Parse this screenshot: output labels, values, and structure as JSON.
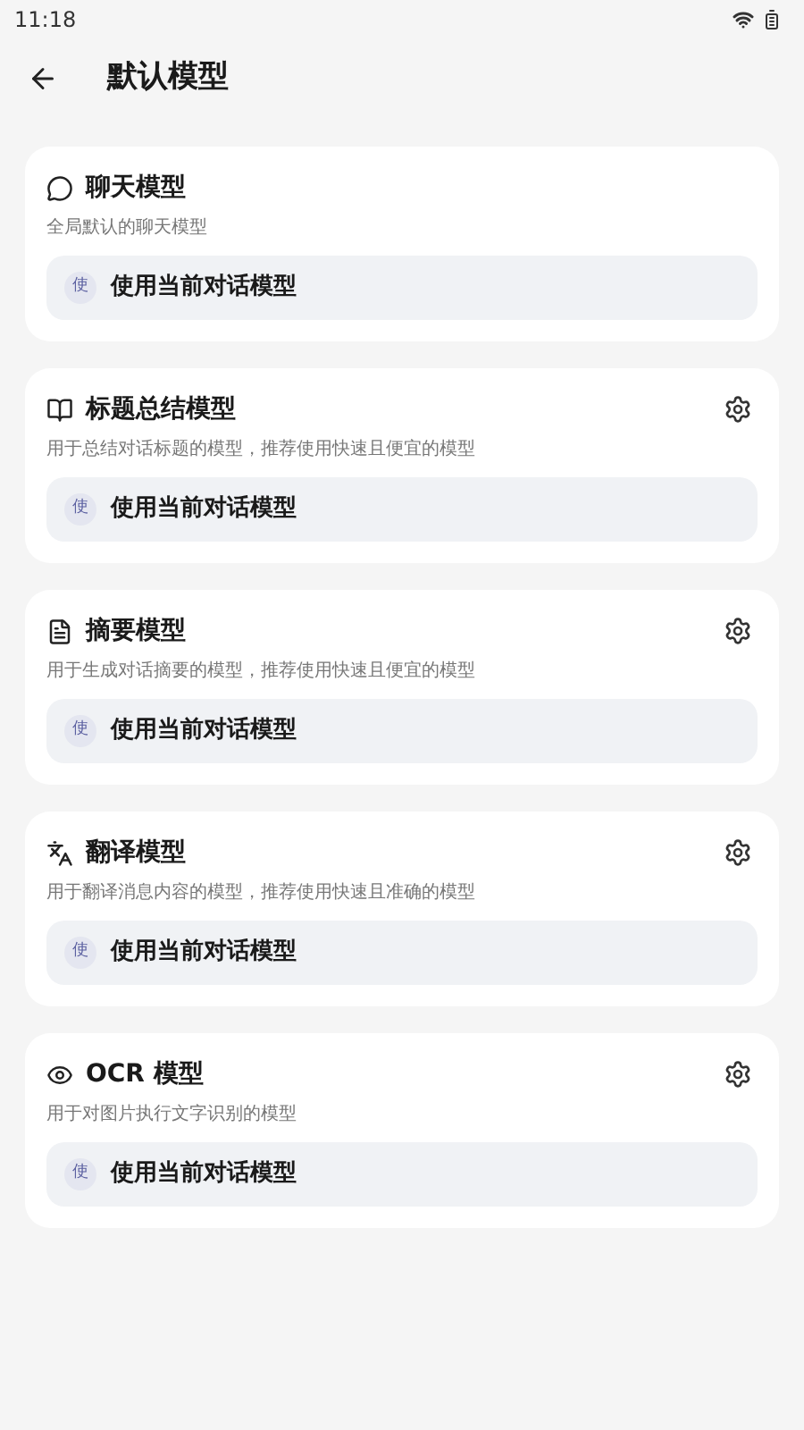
{
  "status_bar": {
    "time": "11:18"
  },
  "header": {
    "title": "默认模型"
  },
  "cards": [
    {
      "kind": "chat",
      "title": "聊天模型",
      "description": "全局默认的聊天模型",
      "settings": false,
      "selector": {
        "avatar": "使",
        "label": "使用当前对话模型"
      }
    },
    {
      "kind": "summary",
      "title": "标题总结模型",
      "description": "用于总结对话标题的模型，推荐使用快速且便宜的模型",
      "settings": true,
      "selector": {
        "avatar": "使",
        "label": "使用当前对话模型"
      }
    },
    {
      "kind": "document",
      "title": "摘要模型",
      "description": "用于生成对话摘要的模型，推荐使用快速且便宜的模型",
      "settings": true,
      "selector": {
        "avatar": "使",
        "label": "使用当前对话模型"
      }
    },
    {
      "kind": "translate",
      "title": "翻译模型",
      "description": "用于翻译消息内容的模型，推荐使用快速且准确的模型",
      "settings": true,
      "selector": {
        "avatar": "使",
        "label": "使用当前对话模型"
      }
    },
    {
      "kind": "ocr",
      "title": "OCR 模型",
      "description": "用于对图片执行文字识别的模型",
      "settings": true,
      "selector": {
        "avatar": "使",
        "label": "使用当前对话模型"
      }
    }
  ]
}
